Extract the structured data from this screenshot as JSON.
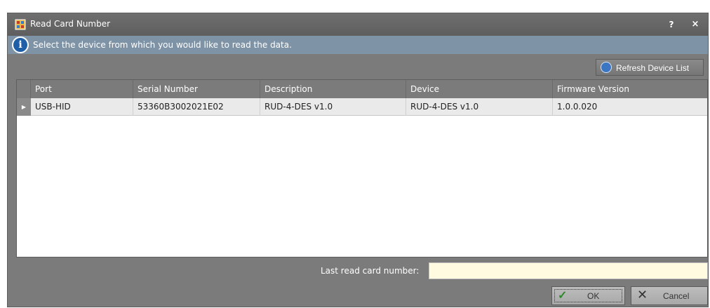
{
  "window": {
    "title": "Read Card Number",
    "help_label": "?",
    "close_label": "×"
  },
  "info": {
    "icon_glyph": "i",
    "text": "Select the device from which you would like to read the data."
  },
  "toolbar": {
    "refresh_label": "Refresh Device List"
  },
  "grid": {
    "columns": [
      "Port",
      "Serial Number",
      "Description",
      "Device",
      "Firmware Version"
    ],
    "rows": [
      [
        "USB-HID",
        "53360B3002021E02",
        "RUD-4-DES v1.0",
        "RUD-4-DES v1.0",
        "1.0.0.020"
      ]
    ],
    "row_indicator": "▶"
  },
  "footer": {
    "last_read_label": "Last read card number:",
    "last_read_value": "",
    "ok_label": "OK",
    "cancel_label": "Cancel"
  },
  "colors": {
    "window_bg": "#7b7b7b",
    "info_bar": "#7e93a6",
    "input_bg": "#fffbe0",
    "selected_row": "#eaeaea"
  }
}
